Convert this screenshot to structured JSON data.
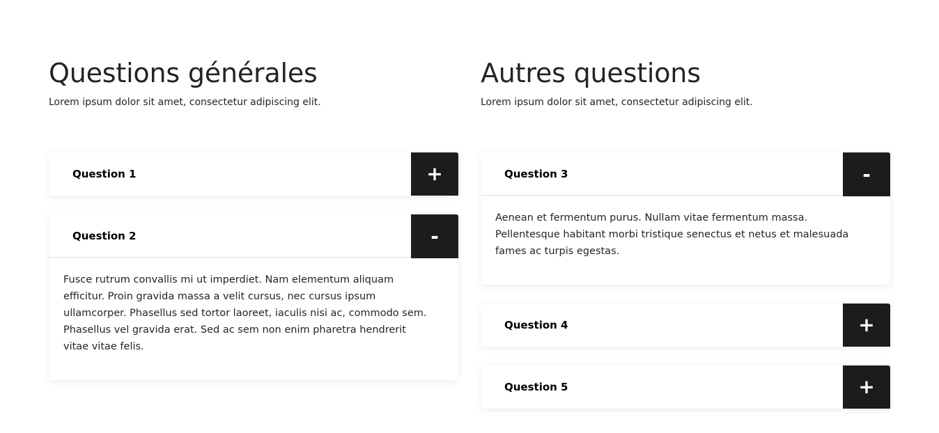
{
  "general": {
    "title": "Questions générales",
    "subtitle": "Lorem ipsum dolor sit amet, consectetur adipiscing elit.",
    "items": [
      {
        "question": "Question 1",
        "toggle": "+",
        "answer": ""
      },
      {
        "question": "Question 2",
        "toggle": "-",
        "answer": "Fusce rutrum convallis mi ut imperdiet. Nam elementum aliquam efficitur. Proin gravida massa a velit cursus, nec cursus ipsum ullamcorper. Phasellus sed tortor laoreet, iaculis nisi ac, commodo sem. Phasellus vel gravida erat. Sed ac sem non enim pharetra hendrerit vitae vitae felis."
      }
    ]
  },
  "other": {
    "title": "Autres questions",
    "subtitle": "Lorem ipsum dolor sit amet, consectetur adipiscing elit.",
    "items": [
      {
        "question": "Question 3",
        "toggle": "-",
        "answer": "Aenean et fermentum purus. Nullam vitae fermentum massa. Pellentesque habitant morbi tristique senectus et netus et malesuada fames ac turpis egestas."
      },
      {
        "question": "Question 4",
        "toggle": "+",
        "answer": ""
      },
      {
        "question": "Question 5",
        "toggle": "+",
        "answer": ""
      }
    ]
  },
  "colors": {
    "toggle_background": "#1c1c1c",
    "toggle_text": "#ffffff",
    "heading_text": "#212529"
  }
}
